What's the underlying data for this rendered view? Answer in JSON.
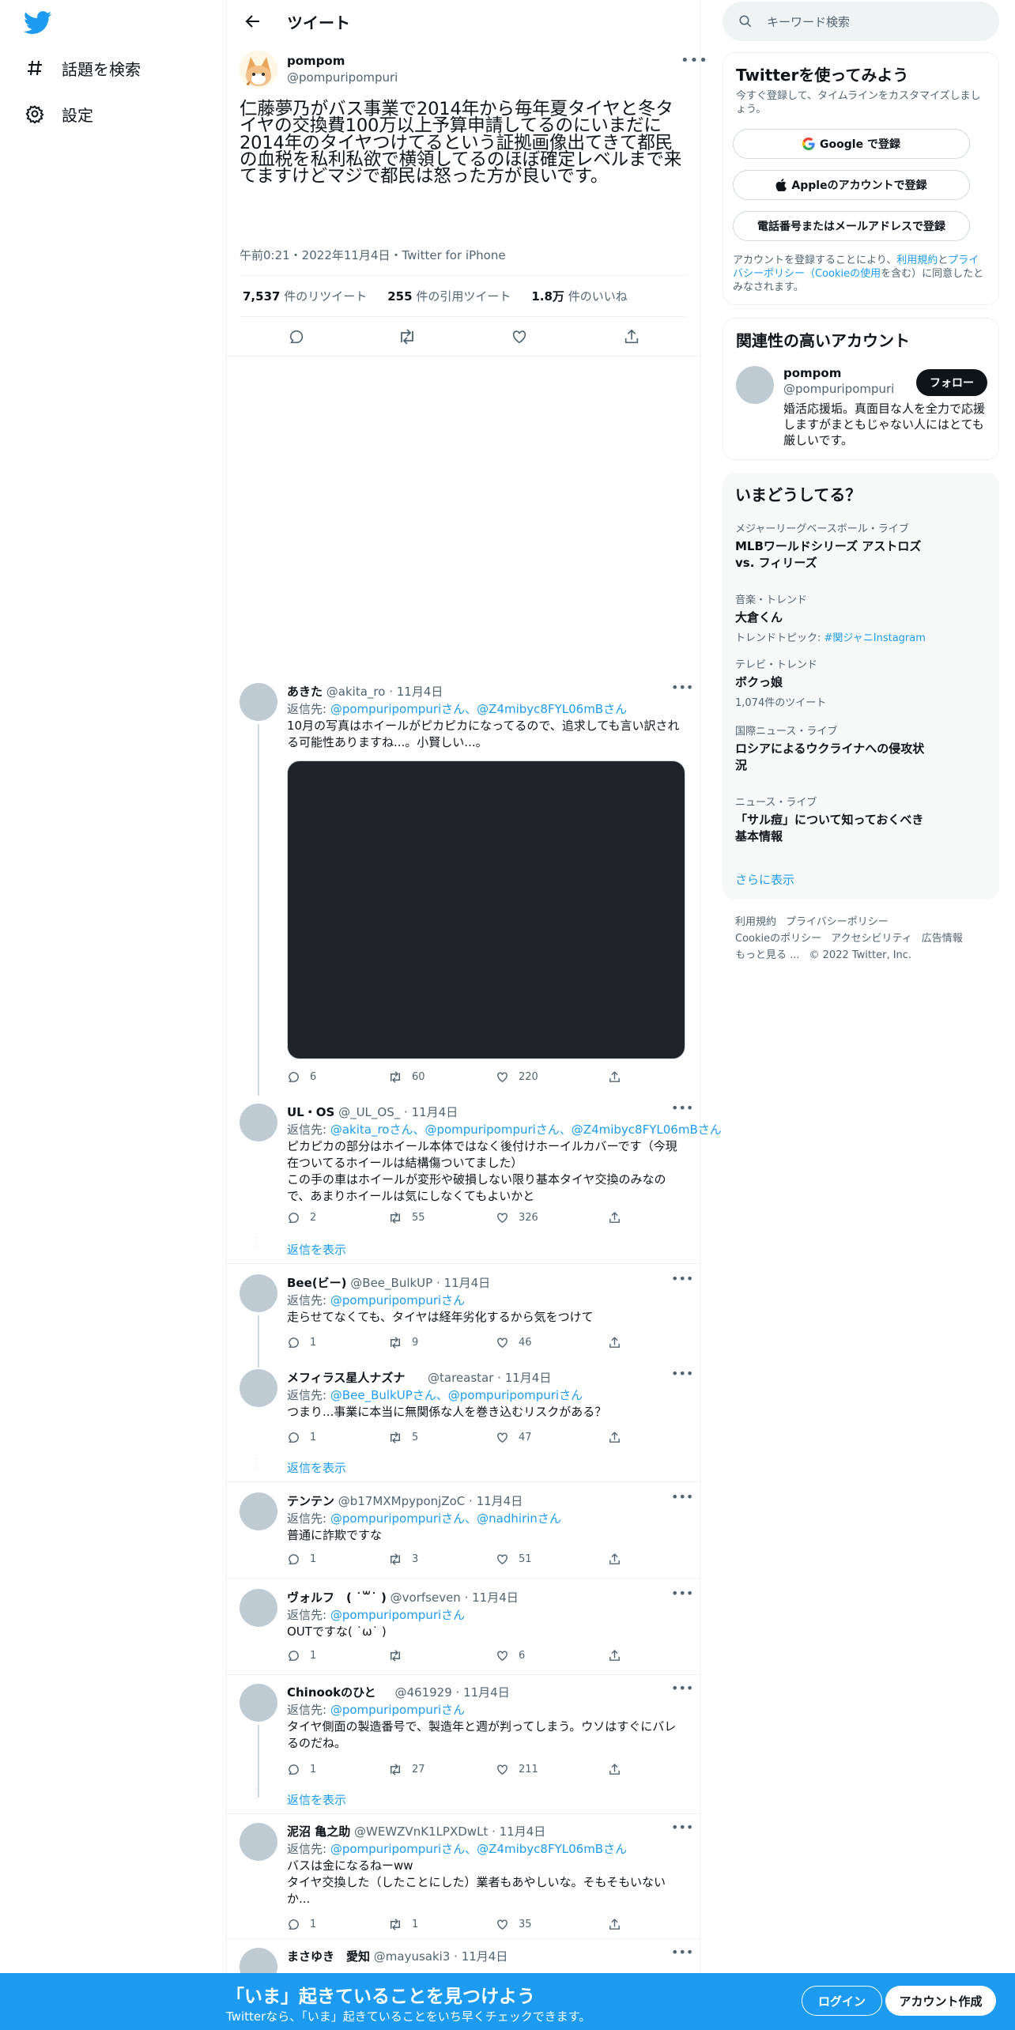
{
  "nav": {
    "explore_label": "話題を検索",
    "settings_label": "設定"
  },
  "header": {
    "title": "ツイート"
  },
  "main_tweet": {
    "name": "pompom",
    "handle": "@pompuripompuri",
    "text": "仁藤夢乃がバス事業で2014年から毎年夏タイヤと冬タイヤの交換費100万以上予算申請してるのにいまだに2014年のタイヤつけてるという証拠画像出てきて都民の血税を私利私欲で横領してるのほぼ確定レベルまで来てますけどマジで都民は怒った方が良いです。",
    "meta": "午前0:21・2022年11月4日・Twitter for iPhone",
    "retweets_count": "7,537",
    "retweets_label": "件のリツイート",
    "quotes_count": "255",
    "quotes_label": "件の引用ツイート",
    "likes_count": "1.8万",
    "likes_label": "件のいいね"
  },
  "replies": [
    {
      "name": "あきた",
      "handle": "@akita_ro",
      "date": "11月4日",
      "to_prefix": "返信先: ",
      "to": "@pompuripompuriさん、@Z4mibyc8FYL06mBさん",
      "text": "10月の写真はホイールがピカピカになってるので、追求しても言い訳される可能性ありますね...。小賢しい...。",
      "reply_count": "6",
      "retweet_count": "60",
      "like_count": "220"
    },
    {
      "name": "UL・OS",
      "handle": "@_UL_OS_",
      "date": "11月4日",
      "to_prefix": "返信先: ",
      "to": "@akita_roさん、@pompuripompuriさん、@Z4mibyc8FYL06mBさん",
      "text": "ピカピカの部分はホイール本体ではなく後付けホーイルカバーです（今現在ついてるホイールは結構傷ついてました）\nこの手の車はホイールが変形や破損しない限り基本タイヤ交換のみなので、あまりホイールは気にしなくてもよいかと",
      "reply_count": "2",
      "retweet_count": "55",
      "like_count": "326"
    },
    {
      "name": "Bee(ビー)",
      "handle": "@Bee_BulkUP",
      "date": "11月4日",
      "to_prefix": "返信先: ",
      "to": "@pompuripompuriさん",
      "text": "走らせてなくても、タイヤは経年劣化するから気をつけて",
      "reply_count": "1",
      "retweet_count": "9",
      "like_count": "46"
    },
    {
      "name": "メフィラス星人ナズナ",
      "handle": "@tareastar",
      "date": "11月4日",
      "to_prefix": "返信先: ",
      "to": "@Bee_BulkUPさん、@pompuripompuriさん",
      "text": "つまり...事業に本当に無関係な人を巻き込むリスクがある？",
      "reply_count": "1",
      "retweet_count": "5",
      "like_count": "47"
    },
    {
      "name": "テンテン",
      "handle": "@b17MXMpyponjZoC",
      "date": "11月4日",
      "to_prefix": "返信先: ",
      "to": "@pompuripompuriさん、@nadhirinさん",
      "text": "普通に詐欺ですな",
      "reply_count": "1",
      "retweet_count": "3",
      "like_count": "51"
    },
    {
      "name": "ヴォルフ　( ˙꒳˙ )",
      "handle": "@vorfseven",
      "date": "11月4日",
      "to_prefix": "返信先: ",
      "to": "@pompuripompuriさん",
      "text": "OUTですな( ˙ω˙ )",
      "reply_count": "1",
      "retweet_count": "",
      "like_count": "6"
    },
    {
      "name": "Chinookのひと",
      "handle": "@461929",
      "date": "11月4日",
      "to_prefix": "返信先: ",
      "to": "@pompuripompuriさん",
      "text": "タイヤ側面の製造番号で、製造年と週が判ってしまう。ウソはすぐにバレるのだね。",
      "reply_count": "1",
      "retweet_count": "27",
      "like_count": "211"
    },
    {
      "name": "泥沼 亀之助",
      "handle": "@WEWZVnK1LPXDwLt",
      "date": "11月4日",
      "to_prefix": "返信先: ",
      "to": "@pompuripompuriさん、@Z4mibyc8FYL06mBさん",
      "text": "バスは金になるねーww\nタイヤ交換した（したことにした）業者もあやしいな。そもそもいないか...",
      "reply_count": "1",
      "retweet_count": "1",
      "like_count": "35"
    },
    {
      "name": "まさゆき　愛知",
      "handle": "@mayusaki3",
      "date": "11月4日",
      "to_prefix": "",
      "to": "",
      "text": "",
      "reply_count": "",
      "retweet_count": "",
      "like_count": ""
    }
  ],
  "show_replies_label": "返信を表示",
  "right": {
    "search_placeholder": "キーワード検索",
    "signup_card": {
      "title": "Twitterを使ってみよう",
      "subtitle": "今すぐ登録して、タイムラインをカスタマイズしましょう。",
      "google_label": "Google で登録",
      "apple_label": "Appleのアカウントで登録",
      "phone_label": "電話番号またはメールアドレスで登録",
      "terms_1": "アカウントを登録することにより、",
      "terms_link_1": "利用規約",
      "terms_2": "と",
      "terms_link_2": "プライバシーポリシー（Cookieの使用",
      "terms_3": "を含む）に同意したとみなされます。"
    },
    "related_card": {
      "title": "関連性の高いアカウント",
      "name": "pompom",
      "handle": "@pompuripompuri",
      "follow_label": "フォロー",
      "bio": "婚活応援垢。真面目な人を全力で応援しますがまともじゃない人にはとても厳しいです。"
    },
    "trends_card": {
      "title": "いまどうしてる？",
      "items": [
        {
          "category": "メジャーリーグベースボール・ライブ",
          "name": "MLBワールドシリーズ アストロズ vs. フィリーズ",
          "sub": ""
        },
        {
          "category": "音楽・トレンド",
          "name": "大倉くん",
          "sub_prefix": "トレンドトピック: ",
          "sub": "#関ジャニInstagram"
        },
        {
          "category": "テレビ・トレンド",
          "name": "ボクっ娘",
          "sub": "1,074件のツイート"
        },
        {
          "category": "国際ニュース・ライブ",
          "name": "ロシアによるウクライナへの侵攻状況",
          "sub": ""
        },
        {
          "category": "ニュース・ライブ",
          "name": "「サル痘」について知っておくべき基本情報",
          "sub": ""
        }
      ],
      "more_label": "さらに表示"
    },
    "footer": {
      "links": [
        "利用規約",
        "プライバシーポリシー",
        "Cookieのポリシー",
        "アクセシビリティ",
        "広告情報",
        "もっと見る ..."
      ],
      "copyright": "© 2022 Twitter, Inc."
    }
  },
  "bottom_bar": {
    "title": "「いま」起きていることを見つけよう",
    "subtitle": "Twitterなら、「いま」起きていることをいち早くチェックできます。",
    "login_label": "ログイン",
    "signup_label": "アカウント作成"
  },
  "colors": {
    "accent": "#1d9bf0",
    "text": "#0f1419",
    "muted": "#536471"
  }
}
